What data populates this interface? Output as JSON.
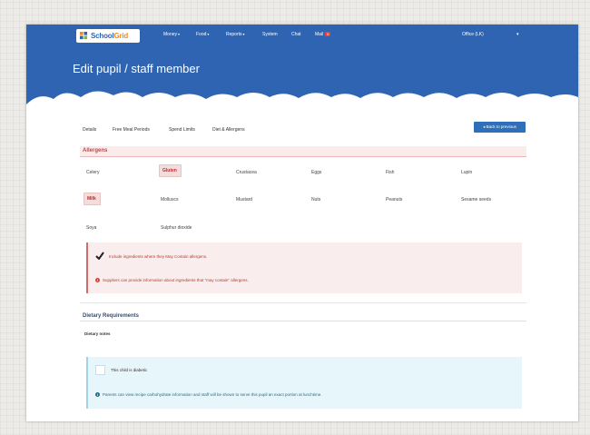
{
  "nav": {
    "logo": {
      "part1": "School",
      "part2": "Grid"
    },
    "items": [
      {
        "label": "Money",
        "caret": "▾"
      },
      {
        "label": "Food",
        "caret": "▾"
      },
      {
        "label": "Reports",
        "caret": "▾"
      },
      {
        "label": "System",
        "caret": ""
      },
      {
        "label": "Chat",
        "caret": ""
      },
      {
        "label": "Mail",
        "caret": ""
      }
    ],
    "mail_badge": "9",
    "user": "Office (LK)",
    "user_caret": "▾"
  },
  "page": {
    "title": "Edit pupil / staff member"
  },
  "tabs": [
    "Details",
    "Free Meal Periods",
    "Spend Limits",
    "Diet & Allergens"
  ],
  "back_button": "◂ Back to previous",
  "allergens": {
    "heading": "Allergens",
    "items": [
      {
        "label": "Celery",
        "selected": false
      },
      {
        "label": "Gluten",
        "selected": true
      },
      {
        "label": "Crustacea",
        "selected": false
      },
      {
        "label": "Eggs",
        "selected": false
      },
      {
        "label": "Fish",
        "selected": false
      },
      {
        "label": "Lupin",
        "selected": false
      },
      {
        "label": "Milk",
        "selected": true
      },
      {
        "label": "Molluscs",
        "selected": false
      },
      {
        "label": "Mustard",
        "selected": false
      },
      {
        "label": "Nuts",
        "selected": false
      },
      {
        "label": "Peanuts",
        "selected": false
      },
      {
        "label": "Sesame seeds",
        "selected": false
      },
      {
        "label": "Soya",
        "selected": false
      },
      {
        "label": "Sulphur dioxide",
        "selected": false
      }
    ]
  },
  "may_contain": {
    "checkbox_label": "Include ingredients where they May Contain allergens.",
    "checked": true,
    "info": "Suppliers can provide information about ingredients that \"may contain\" allergens."
  },
  "dietary": {
    "heading": "Dietary Requirements",
    "notes_label": "Dietary notes",
    "diabetic_label": "This child is diabetic",
    "diabetic_checked": false,
    "info": "Parents can view recipe carbohydrate information and staff will be shown to serve this pupil an exact portion at lunchtime."
  },
  "colors": {
    "header_blue": "#2f64b3",
    "allergen_red": "#b54a4a",
    "info_blue": "#2b6d88"
  }
}
